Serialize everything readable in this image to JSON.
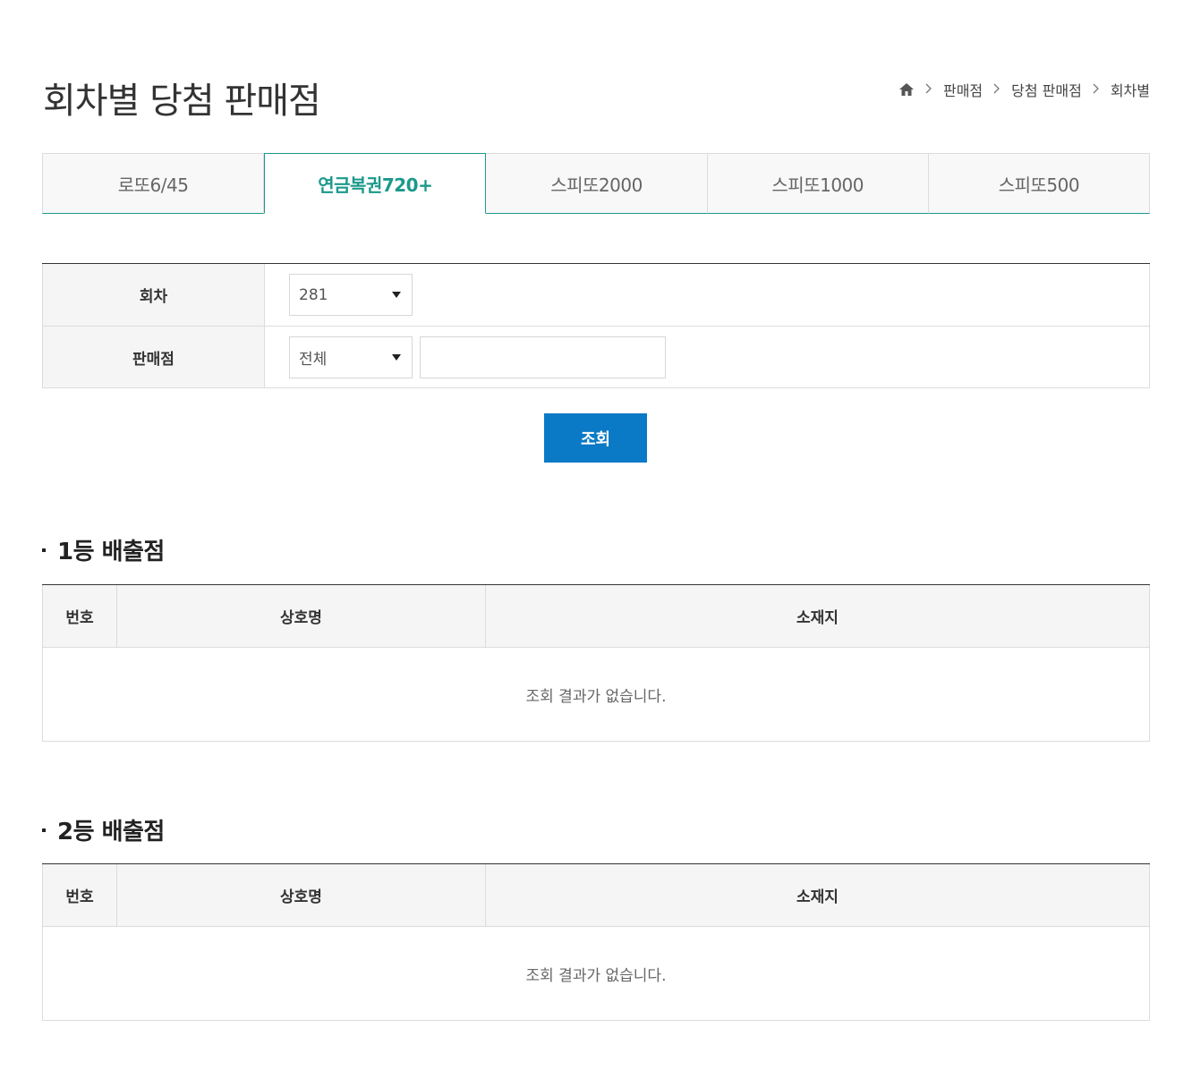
{
  "header": {
    "title": "회차별 당첨 판매점",
    "breadcrumb": [
      "판매점",
      "당첨 판매점",
      "회차별"
    ]
  },
  "tabs": [
    {
      "label": "로또6/45",
      "active": false
    },
    {
      "label": "연금복권720+",
      "active": true
    },
    {
      "label": "스피또2000",
      "active": false
    },
    {
      "label": "스피또1000",
      "active": false
    },
    {
      "label": "스피또500",
      "active": false
    }
  ],
  "search": {
    "round_label": "회차",
    "round_value": "281",
    "store_label": "판매점",
    "store_scope_value": "전체",
    "store_name_value": "",
    "submit_label": "조회"
  },
  "sections": [
    {
      "title": "1등 배출점",
      "columns": [
        "번호",
        "상호명",
        "소재지"
      ],
      "empty_message": "조회 결과가 없습니다."
    },
    {
      "title": "2등 배출점",
      "columns": [
        "번호",
        "상호명",
        "소재지"
      ],
      "empty_message": "조회 결과가 없습니다."
    }
  ],
  "colors": {
    "accent": "#1b998b",
    "button": "#0a7ac6"
  },
  "icons": {
    "home": "home-icon",
    "separator": "chevron-right-icon",
    "select_caret": "caret-down-icon"
  }
}
